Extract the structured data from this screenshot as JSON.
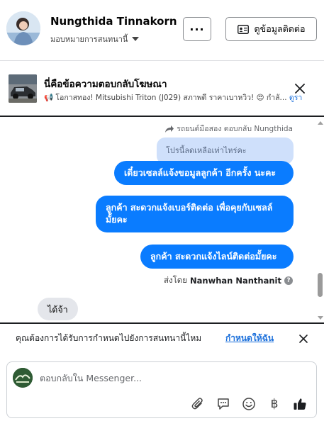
{
  "header": {
    "customer_name": "Nungthida Tinnakorn",
    "assign_label": "มอบหมายการสนทนานี้",
    "more_label": "···",
    "contact_label": "ดูข้อมูลติดต่อ"
  },
  "ad_reply": {
    "title": "นี่คือข้อความตอบกลับโฆษณา",
    "subtitle": "📢 โอกาสทอง! Mitsubishi Triton (J029) สภาพดี ราคาเบาหวิว! 😍 กำลั...",
    "link": "ดูรา"
  },
  "conversation": {
    "reply_meta": "รถยนต์มือสอง ตอบกลับ Nungthida",
    "quoted_text": "โปรนี้ลดเหลือเท่าไหร่คะ",
    "messages": [
      "เดี๋ยวเซลล์แจ้งขอมูลลูกค้า  อีกครั้ง นะคะ",
      "ลูกค้า  สะดวกแจ้งเบอร์ติดต่อ เพื่อคุยกับเซลล์ มั้ยคะ",
      "ลูกค้า  สะดวกแจ้งไลน์ติดต่อมั้ยคะ"
    ],
    "sent_by_prefix": "ส่งโดย",
    "sent_by_name": "Nanwhan Nanthanit",
    "incoming_message": "ได้จ้า"
  },
  "assign_prompt": {
    "question": "คุณต้องการได้รับการกำหนดไปยังการสนทนานี้ไหม",
    "action": "กำหนดให้ฉัน"
  },
  "composer": {
    "placeholder": "ตอบกลับใน Messenger...",
    "baht_symbol": "฿"
  },
  "colors": {
    "brand_blue": "#0a7cff",
    "quoted_bg": "#cfe0fb",
    "link_blue": "#1a6fdb"
  }
}
